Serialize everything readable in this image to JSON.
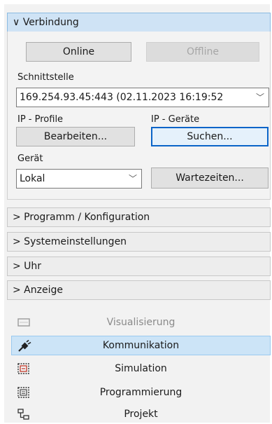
{
  "connection": {
    "header": "∨ Verbindung",
    "online_label": "Online",
    "offline_label": "Offline",
    "interface_label": "Schnittstelle",
    "interface_value": "169.254.93.45:443 (02.11.2023 16:19:52",
    "ip_profiles_label": "IP - Profile",
    "ip_devices_label": "IP - Geräte",
    "edit_label": "Bearbeiten...",
    "search_label": "Suchen...",
    "device_label": "Gerät",
    "device_value": "Lokal",
    "wait_times_label": "Wartezeiten..."
  },
  "sections": [
    {
      "label": "> Programm / Konfiguration"
    },
    {
      "label": "> Systemeinstellungen"
    },
    {
      "label": "> Uhr"
    },
    {
      "label": "> Anzeige"
    }
  ],
  "nav": [
    {
      "label": "Visualisierung",
      "icon": "monitor-icon",
      "state": "inactive"
    },
    {
      "label": "Kommunikation",
      "icon": "plug-icon",
      "state": "selected"
    },
    {
      "label": "Simulation",
      "icon": "simulation-icon",
      "state": "normal"
    },
    {
      "label": "Programmierung",
      "icon": "programming-icon",
      "state": "normal"
    },
    {
      "label": "Projekt",
      "icon": "project-tree-icon",
      "state": "normal"
    }
  ],
  "colors": {
    "header_selected": "#cfe3f5",
    "nav_selected": "#cce4f7",
    "focus_border": "#0a64c8",
    "icon_red": "#c0392b"
  }
}
